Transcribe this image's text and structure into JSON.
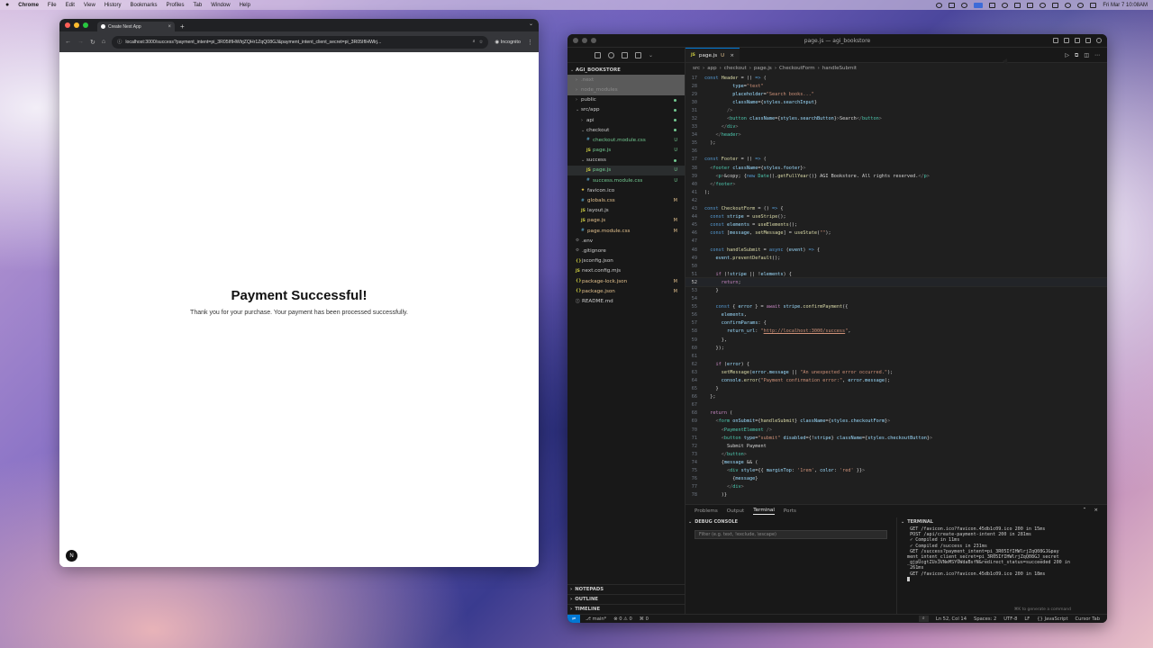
{
  "menubar": {
    "app": "Chrome",
    "items": [
      "File",
      "Edit",
      "View",
      "History",
      "Bookmarks",
      "Profiles",
      "Tab",
      "Window",
      "Help"
    ],
    "clock": "Fri Mar 7  10:08AM"
  },
  "chrome": {
    "tab_title": "Create Next App",
    "url": "localhost:3000/success?payment_intent=pi_3R05IfIHWlrjZQHr1ZqQ08GJ&payment_intent_client_secret=pi_3R05IfIHWlrj...",
    "incognito_label": "Incognito",
    "page_title": "Payment Successful!",
    "page_message": "Thank you for your purchase. Your payment has been processed successfully.",
    "next_badge": "N"
  },
  "vscode": {
    "window_title": "page.js — agi_bookstore",
    "explorer_root": "AGI_BOOKSTORE",
    "tree": [
      {
        "name": ".next",
        "depth": 1,
        "kind": "folder",
        "state": "gray"
      },
      {
        "name": "node_modules",
        "depth": 1,
        "kind": "folder",
        "state": "gray"
      },
      {
        "name": "public",
        "depth": 1,
        "kind": "folder",
        "state": "dot"
      },
      {
        "name": "src/app",
        "depth": 1,
        "kind": "folder-open",
        "state": "dot"
      },
      {
        "name": "api",
        "depth": 2,
        "kind": "folder",
        "state": "dot"
      },
      {
        "name": "checkout",
        "depth": 2,
        "kind": "folder-open",
        "state": "dot"
      },
      {
        "name": "checkout.module.css",
        "depth": 3,
        "kind": "css",
        "badge": "U"
      },
      {
        "name": "page.js",
        "depth": 3,
        "kind": "js",
        "badge": "U"
      },
      {
        "name": "success",
        "depth": 2,
        "kind": "folder-open",
        "state": "dot"
      },
      {
        "name": "page.js",
        "depth": 3,
        "kind": "js",
        "badge": "U",
        "active": true
      },
      {
        "name": "success.module.css",
        "depth": 3,
        "kind": "css",
        "badge": "U"
      },
      {
        "name": "favicon.ico",
        "depth": 2,
        "kind": "star"
      },
      {
        "name": "globals.css",
        "depth": 2,
        "kind": "css",
        "badge": "M"
      },
      {
        "name": "layout.js",
        "depth": 2,
        "kind": "js"
      },
      {
        "name": "page.js",
        "depth": 2,
        "kind": "js",
        "badge": "M"
      },
      {
        "name": "page.module.css",
        "depth": 2,
        "kind": "css",
        "badge": "M"
      },
      {
        "name": ".env",
        "depth": 1,
        "kind": "env"
      },
      {
        "name": ".gitignore",
        "depth": 1,
        "kind": "env"
      },
      {
        "name": "jsconfig.json",
        "depth": 1,
        "kind": "json"
      },
      {
        "name": "next.config.mjs",
        "depth": 1,
        "kind": "js"
      },
      {
        "name": "package-lock.json",
        "depth": 1,
        "kind": "json",
        "badge": "M"
      },
      {
        "name": "package.json",
        "depth": 1,
        "kind": "json",
        "badge": "M"
      },
      {
        "name": "README.md",
        "depth": 1,
        "kind": "md"
      }
    ],
    "outline_sections": [
      "NOTEPADS",
      "OUTLINE",
      "TIMELINE"
    ],
    "editor_tab": "page.js",
    "editor_tab_badge": "U",
    "breadcrumbs": [
      "src",
      "app",
      "checkout",
      "page.js",
      "CheckoutForm",
      "handleSubmit"
    ],
    "current_line": 52,
    "code": [
      {
        "n": 17,
        "h": "<span class='k'>const</span> <span class='f'>Header</span> = () <span class='k'>=&gt;</span> ("
      },
      {
        "n": 28,
        "h": "          <span class='v'>type</span>=<span class='s'>\"text\"</span>"
      },
      {
        "n": 29,
        "h": "          <span class='v'>placeholder</span>=<span class='s'>\"Search books...\"</span>"
      },
      {
        "n": 30,
        "h": "          <span class='v'>className</span>={<span class='v'>styles</span>.<span class='v'>searchInput</span>}"
      },
      {
        "n": 31,
        "h": "        <span class='c'>/&gt;</span>"
      },
      {
        "n": 32,
        "h": "        <span class='c'>&lt;</span><span class='tg'>button</span> <span class='v'>className</span>={<span class='v'>styles</span>.<span class='v'>searchButton</span>}<span class='c'>&gt;</span>Search<span class='c'>&lt;/</span><span class='tg'>button</span><span class='c'>&gt;</span>"
      },
      {
        "n": 33,
        "h": "      <span class='c'>&lt;/</span><span class='tg'>div</span><span class='c'>&gt;</span>"
      },
      {
        "n": 34,
        "h": "    <span class='c'>&lt;/</span><span class='tg'>header</span><span class='c'>&gt;</span>"
      },
      {
        "n": 35,
        "h": "  );"
      },
      {
        "n": 36,
        "h": ""
      },
      {
        "n": 37,
        "h": "<span class='k'>const</span> <span class='f'>Footer</span> = () <span class='k'>=&gt;</span> ("
      },
      {
        "n": 38,
        "h": "  <span class='c'>&lt;</span><span class='tg'>footer</span> <span class='v'>className</span>={<span class='v'>styles</span>.<span class='v'>footer</span>}<span class='c'>&gt;</span>"
      },
      {
        "n": 39,
        "h": "    <span class='c'>&lt;</span><span class='tg'>p</span><span class='c'>&gt;</span>&amp;copy; {<span class='k'>new</span> <span class='t'>Date</span>().<span class='f'>getFullYear</span>()} AGI Bookstore. All rights reserved.<span class='c'>&lt;/</span><span class='tg'>p</span><span class='c'>&gt;</span>"
      },
      {
        "n": 40,
        "h": "  <span class='c'>&lt;/</span><span class='tg'>footer</span><span class='c'>&gt;</span>"
      },
      {
        "n": 41,
        "h": ");"
      },
      {
        "n": 42,
        "h": ""
      },
      {
        "n": 43,
        "h": "<span class='k'>const</span> <span class='f'>CheckoutForm</span> = () <span class='k'>=&gt;</span> {"
      },
      {
        "n": 44,
        "h": "  <span class='k'>const</span> <span class='v'>stripe</span> = <span class='f'>useStripe</span>();"
      },
      {
        "n": 45,
        "h": "  <span class='k'>const</span> <span class='v'>elements</span> = <span class='f'>useElements</span>();"
      },
      {
        "n": 46,
        "h": "  <span class='k'>const</span> [<span class='v'>message</span>, <span class='f'>setMessage</span>] = <span class='f'>useState</span>(<span class='s'>\"\"</span>);"
      },
      {
        "n": 47,
        "h": ""
      },
      {
        "n": 48,
        "h": "  <span class='k'>const</span> <span class='f'>handleSubmit</span> = <span class='k'>async</span> (<span class='v'>event</span>) <span class='k'>=&gt;</span> {"
      },
      {
        "n": 49,
        "h": "    <span class='v'>event</span>.<span class='f'>preventDefault</span>();"
      },
      {
        "n": 50,
        "h": ""
      },
      {
        "n": 51,
        "h": "    <span class='p'>if</span> (!<span class='v'>stripe</span> || !<span class='v'>elements</span>) {"
      },
      {
        "n": 52,
        "h": "      <span class='p'>return</span>;"
      },
      {
        "n": 53,
        "h": "    }"
      },
      {
        "n": 54,
        "h": ""
      },
      {
        "n": 55,
        "h": "    <span class='k'>const</span> { <span class='v'>error</span> } = <span class='p'>await</span> <span class='v'>stripe</span>.<span class='f'>confirmPayment</span>({"
      },
      {
        "n": 56,
        "h": "      <span class='v'>elements</span>,"
      },
      {
        "n": 57,
        "h": "      <span class='v'>confirmParams</span>: {"
      },
      {
        "n": 58,
        "h": "        <span class='v'>return_url</span>: <span class='s'>\"<u>http://localhost:3000/success</u>\"</span>,"
      },
      {
        "n": 59,
        "h": "      },"
      },
      {
        "n": 60,
        "h": "    });"
      },
      {
        "n": 61,
        "h": ""
      },
      {
        "n": 62,
        "h": "    <span class='p'>if</span> (<span class='v'>error</span>) {"
      },
      {
        "n": 63,
        "h": "      <span class='f'>setMessage</span>(<span class='v'>error</span>.<span class='v'>message</span> || <span class='s'>\"An unexpected error occurred.\"</span>);"
      },
      {
        "n": 64,
        "h": "      <span class='v'>console</span>.<span class='f'>error</span>(<span class='s'>\"Payment confirmation error:\"</span>, <span class='v'>error</span>.<span class='v'>message</span>);"
      },
      {
        "n": 65,
        "h": "    }"
      },
      {
        "n": 66,
        "h": "  };"
      },
      {
        "n": 67,
        "h": ""
      },
      {
        "n": 68,
        "h": "  <span class='p'>return</span> ("
      },
      {
        "n": 69,
        "h": "    <span class='c'>&lt;</span><span class='tg'>form</span> <span class='v'>onSubmit</span>={<span class='f'>handleSubmit</span>} <span class='v'>className</span>={<span class='v'>styles</span>.<span class='v'>checkoutForm</span>}<span class='c'>&gt;</span>"
      },
      {
        "n": 70,
        "h": "      <span class='c'>&lt;</span><span class='t'>PaymentElement</span> <span class='c'>/&gt;</span>"
      },
      {
        "n": 71,
        "h": "      <span class='c'>&lt;</span><span class='tg'>button</span> <span class='v'>type</span>=<span class='s'>\"submit\"</span> <span class='v'>disabled</span>={!<span class='v'>stripe</span>} <span class='v'>className</span>={<span class='v'>styles</span>.<span class='v'>checkoutButton</span>}<span class='c'>&gt;</span>"
      },
      {
        "n": 72,
        "h": "        Submit Payment"
      },
      {
        "n": 73,
        "h": "      <span class='c'>&lt;/</span><span class='tg'>button</span><span class='c'>&gt;</span>"
      },
      {
        "n": 74,
        "h": "      {<span class='v'>message</span> &amp;&amp; ("
      },
      {
        "n": 75,
        "h": "        <span class='c'>&lt;</span><span class='tg'>div</span> <span class='v'>style</span>={{ <span class='v'>marginTop</span>: <span class='s'>'1rem'</span>, <span class='v'>color</span>: <span class='s'>'red'</span> }}<span class='c'>&gt;</span>"
      },
      {
        "n": 76,
        "h": "          {<span class='v'>message</span>}"
      },
      {
        "n": 77,
        "h": "        <span class='c'>&lt;/</span><span class='tg'>div</span><span class='c'>&gt;</span>"
      },
      {
        "n": 78,
        "h": "      )}"
      }
    ],
    "panel_tabs": [
      "Problems",
      "Output",
      "Terminal",
      "Ports"
    ],
    "panel_active": "Terminal",
    "debug_console_label": "DEBUG CONSOLE",
    "filter_placeholder": "Filter (e.g. text, !exclude, \\escape)",
    "terminal_label": "TERMINAL",
    "terminal_lines": [
      " GET /favicon.ico?favicon.45db1c09.ico 200 in 15ms",
      " POST /api/create-payment-intent 200 in 281ms",
      " ✓ Compiled in 11ms",
      " ✓ Compiled /success in 231ms",
      " GET /success?payment_intent=pi_3R05IfIHWlrjZqQ08GJ&pay",
      "ment_intent_client_secret=pi_3R05IfIHWlrjZqQ08GJ_secret",
      "_gjpUcgtZUx3VNeMSYOWdaBsfN&redirect_status=succeeded 200 in",
      " 261ms",
      " GET /favicon.ico?favicon.45db1c09.ico 200 in 18ms"
    ],
    "terminal_hint": "⌘K to generate a command",
    "status": {
      "branch": "main*",
      "errors": "0",
      "warnings": "0",
      "ports": "0",
      "position": "Ln 52, Col 14",
      "spaces": "Spaces: 2",
      "encoding": "UTF-8",
      "eol": "LF",
      "language": "{} JavaScript",
      "tab_mode": "Cursor Tab"
    }
  }
}
